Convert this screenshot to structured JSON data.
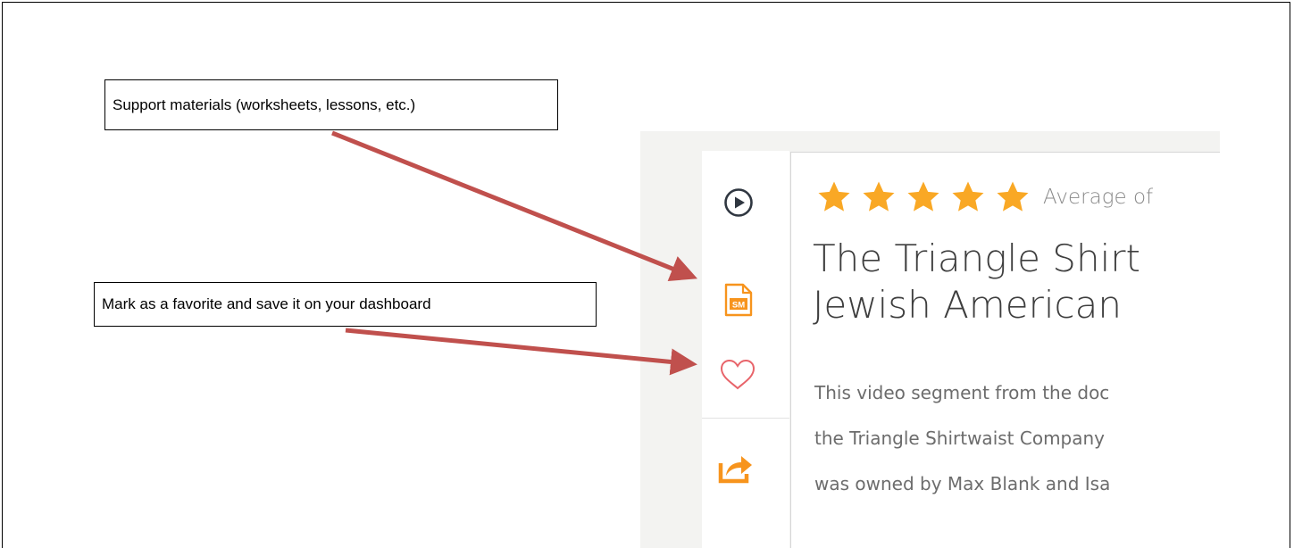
{
  "callouts": {
    "support": "Support materials (worksheets, lessons, etc.)",
    "favorite": "Mark as a favorite and save it on your dashboard"
  },
  "sidebar": {
    "icons": [
      "play-icon",
      "support-materials-icon",
      "heart-icon",
      "share-icon"
    ],
    "sm_badge": "SM"
  },
  "card": {
    "rating": {
      "stars": 5,
      "text": "Average of"
    },
    "title_lines": [
      "The Triangle Shirt",
      "Jewish American"
    ],
    "description_lines": [
      "This video segment from the doc",
      "the Triangle Shirtwaist Company",
      "was owned by Max Blank and Isa"
    ]
  },
  "colors": {
    "accent_orange": "#f7941d",
    "star_gold": "#f9a825",
    "heart_red": "#e8646a",
    "arrow_red": "#c0504d",
    "icon_dark": "#2f3640"
  }
}
